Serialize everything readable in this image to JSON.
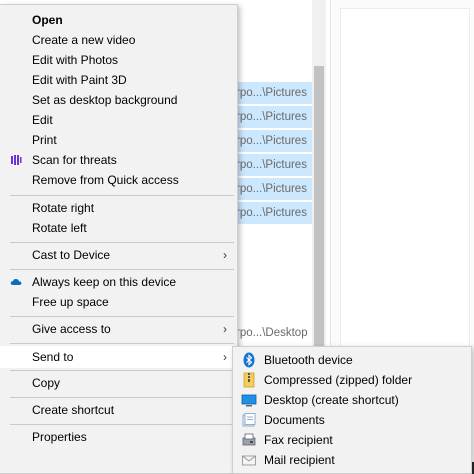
{
  "background": {
    "list_rows": [
      {
        "text": "rpo...\\Pictures",
        "selected": true
      },
      {
        "text": "rpo...\\Pictures",
        "selected": true
      },
      {
        "text": "rpo...\\Pictures",
        "selected": true
      },
      {
        "text": "rpo...\\Pictures",
        "selected": true
      },
      {
        "text": "rpo...\\Pictures",
        "selected": true
      },
      {
        "text": "rpo...\\Pictures",
        "selected": true
      },
      {
        "text": "rpo...\\Desktop",
        "selected": false
      }
    ],
    "selection_color": "#cce8ff"
  },
  "context_menu": {
    "items": {
      "open": "Open",
      "create_video": "Create a new video",
      "edit_photos": "Edit with Photos",
      "edit_paint3d": "Edit with Paint 3D",
      "set_background": "Set as desktop background",
      "edit": "Edit",
      "print": "Print",
      "scan": "Scan for threats",
      "remove_quick": "Remove from Quick access",
      "rotate_right": "Rotate right",
      "rotate_left": "Rotate left",
      "cast": "Cast to Device",
      "keep_device": "Always keep on this device",
      "free_space": "Free up space",
      "give_access": "Give access to",
      "send_to": "Send to",
      "copy": "Copy",
      "create_shortcut": "Create shortcut",
      "properties": "Properties"
    },
    "submenu_arrow": "›",
    "highlighted_item": "Send to"
  },
  "send_to_menu": {
    "items": [
      {
        "label": "Bluetooth device",
        "icon": "bluetooth-icon"
      },
      {
        "label": "Compressed (zipped) folder",
        "icon": "zip-folder-icon"
      },
      {
        "label": "Desktop (create shortcut)",
        "icon": "desktop-icon"
      },
      {
        "label": "Documents",
        "icon": "documents-icon"
      },
      {
        "label": "Fax recipient",
        "icon": "fax-icon"
      },
      {
        "label": "Mail recipient",
        "icon": "mail-icon"
      }
    ]
  },
  "colors": {
    "menu_bg": "#f2f2f2",
    "highlight": "#ffffff",
    "onedrive_blue": "#0f6cbd",
    "scan_purple": "#6b2fd6"
  }
}
